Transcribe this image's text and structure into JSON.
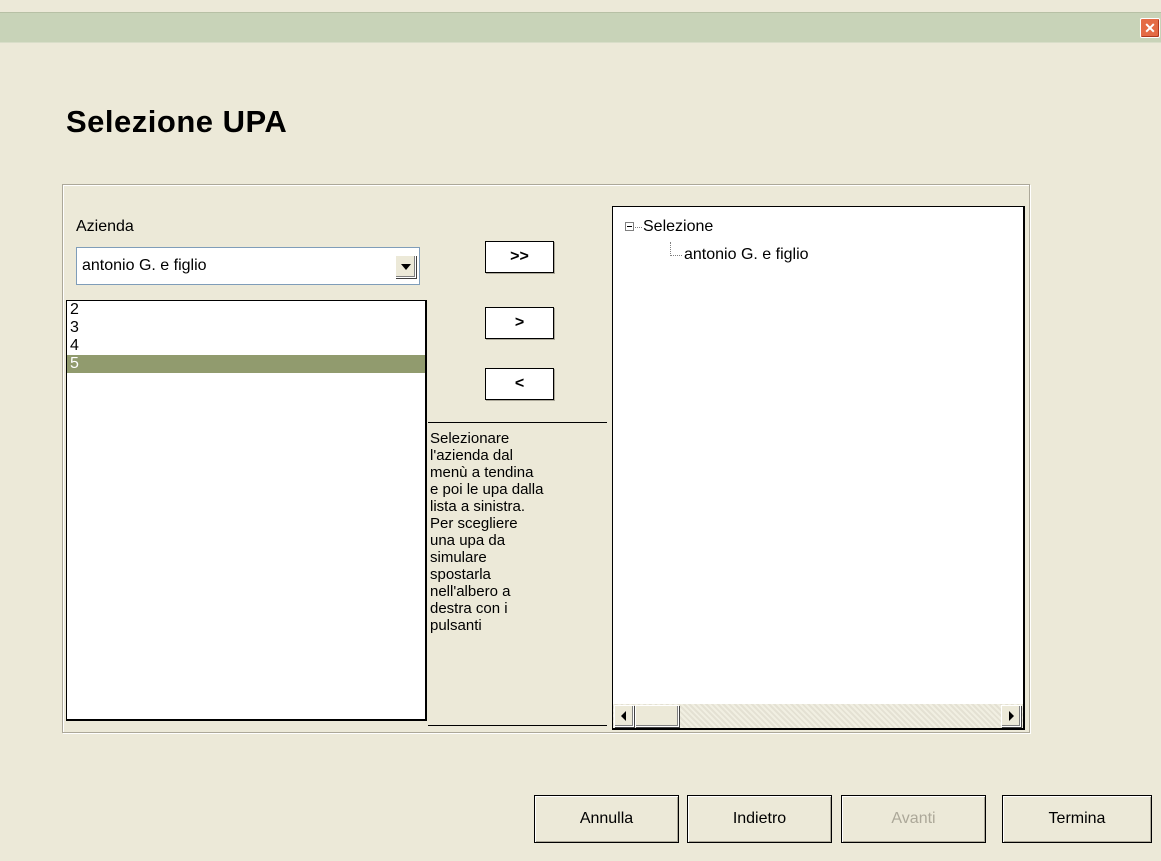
{
  "window": {
    "close_glyph": "✕"
  },
  "page": {
    "heading": "Selezione UPA"
  },
  "azienda": {
    "label": "Azienda",
    "selected": "antonio G. e figlio"
  },
  "upa_list": {
    "items": [
      "2",
      "3",
      "4",
      "5"
    ],
    "selected_index": 3
  },
  "move_buttons": {
    "add_all": ">>",
    "add": ">",
    "remove": "<"
  },
  "help_text": "Selezionare\nl'azienda dal\nmenù a tendina\ne poi le upa dalla\nlista a sinistra.\nPer scegliere\nuna upa da\nsimulare\nspostarla\nnell'albero a\ndestra con i\npulsanti",
  "tree": {
    "root": "Selezione",
    "child": "antonio G. e figlio"
  },
  "footer": {
    "cancel": "Annulla",
    "back": "Indietro",
    "next": "Avanti",
    "finish": "Termina"
  },
  "colors": {
    "background": "#ECE9D8",
    "selection": "#919B6E",
    "disabled_text": "#ACA899",
    "close_button": "#E46B45"
  }
}
